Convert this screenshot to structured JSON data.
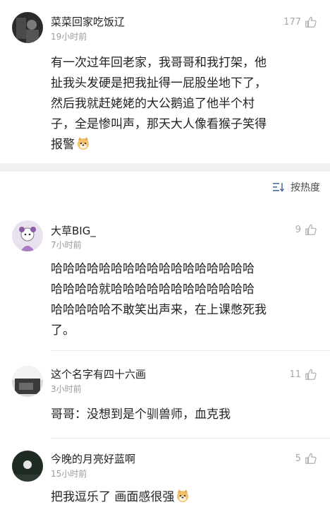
{
  "featured_comment": {
    "username": "菜菜回家吃饭辽",
    "time": "19小时前",
    "likes": "177",
    "lines": [
      "有一次过年回老家，我哥哥和我打架，他",
      "扯我头发硬是把我扯得一屁股坐地下了，",
      "然后我就赶姥姥的大公鹅追了他半个村",
      "子，全是惨叫声，那天大人像看猴子笑得",
      "报警"
    ]
  },
  "sort": {
    "label": "按热度",
    "icon": "sort-list-icon"
  },
  "comments": [
    {
      "username": "大草BIG_",
      "time": "7小时前",
      "likes": "9",
      "lines": [
        "哈哈哈哈哈哈哈哈哈哈哈哈哈哈哈哈哈",
        "哈哈哈哈就哈哈哈哈哈哈哈哈哈哈哈哈",
        "哈哈哈哈哈不敢笑出声来，在上课憋死我",
        "了。"
      ]
    },
    {
      "username": "这个名字有四十六画",
      "time": "3小时前",
      "likes": "11",
      "lines": [
        "哥哥：没想到是个驯兽师，血克我"
      ]
    },
    {
      "username": "今晚的月亮好蓝啊",
      "time": "15小时前",
      "likes": "5",
      "lines": [
        "把我逗乐了 画面感很强"
      ]
    }
  ],
  "icons": {
    "like": "thumbs-up-icon",
    "emoji": "doge-emoji-icon"
  }
}
